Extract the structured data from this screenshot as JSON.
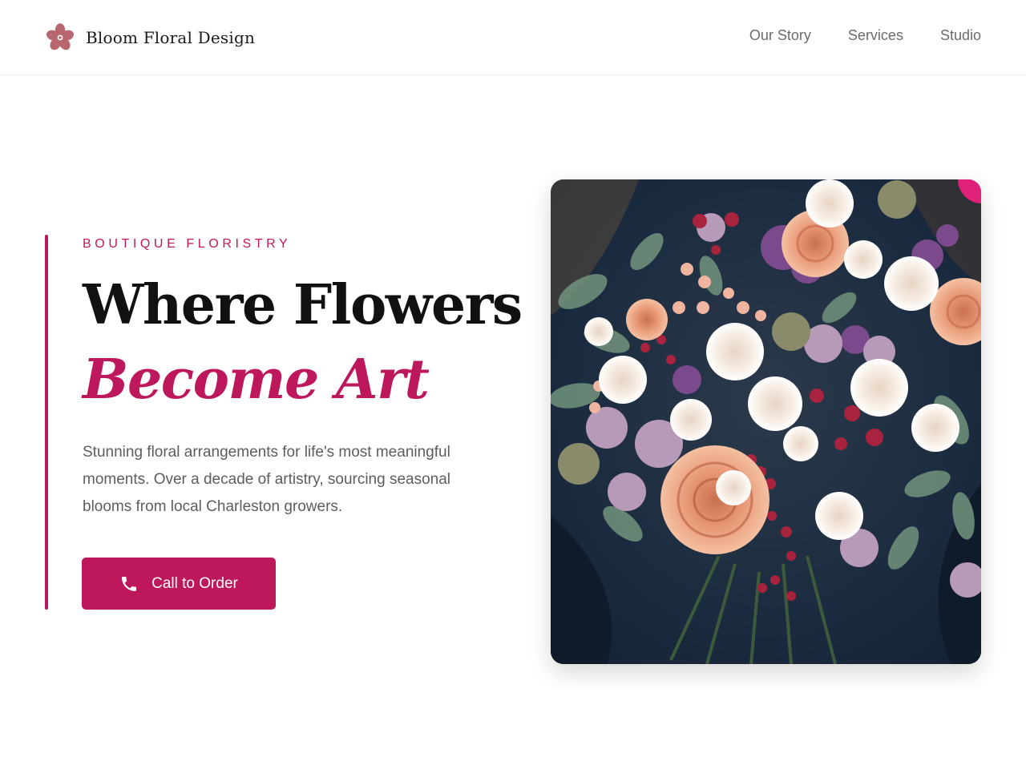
{
  "header": {
    "brand_name": "Bloom Floral Design",
    "logo_icon": "flower-icon",
    "nav": [
      {
        "label": "Our Story"
      },
      {
        "label": "Services"
      },
      {
        "label": "Studio"
      }
    ]
  },
  "hero": {
    "eyebrow": "BOUTIQUE FLORISTRY",
    "headline_line1": "Where Flowers",
    "headline_line2": "Become Art",
    "intro": "Stunning floral arrangements for life's most meaningful moments. Over a decade of artistry, sourcing seasonal blooms from local Charleston growers.",
    "cta_label": "Call to Order",
    "cta_icon": "phone-icon"
  },
  "colors": {
    "accent": "#be185d",
    "logo": "#b9676e",
    "text": "#111111",
    "muted": "#5d5d5d"
  }
}
